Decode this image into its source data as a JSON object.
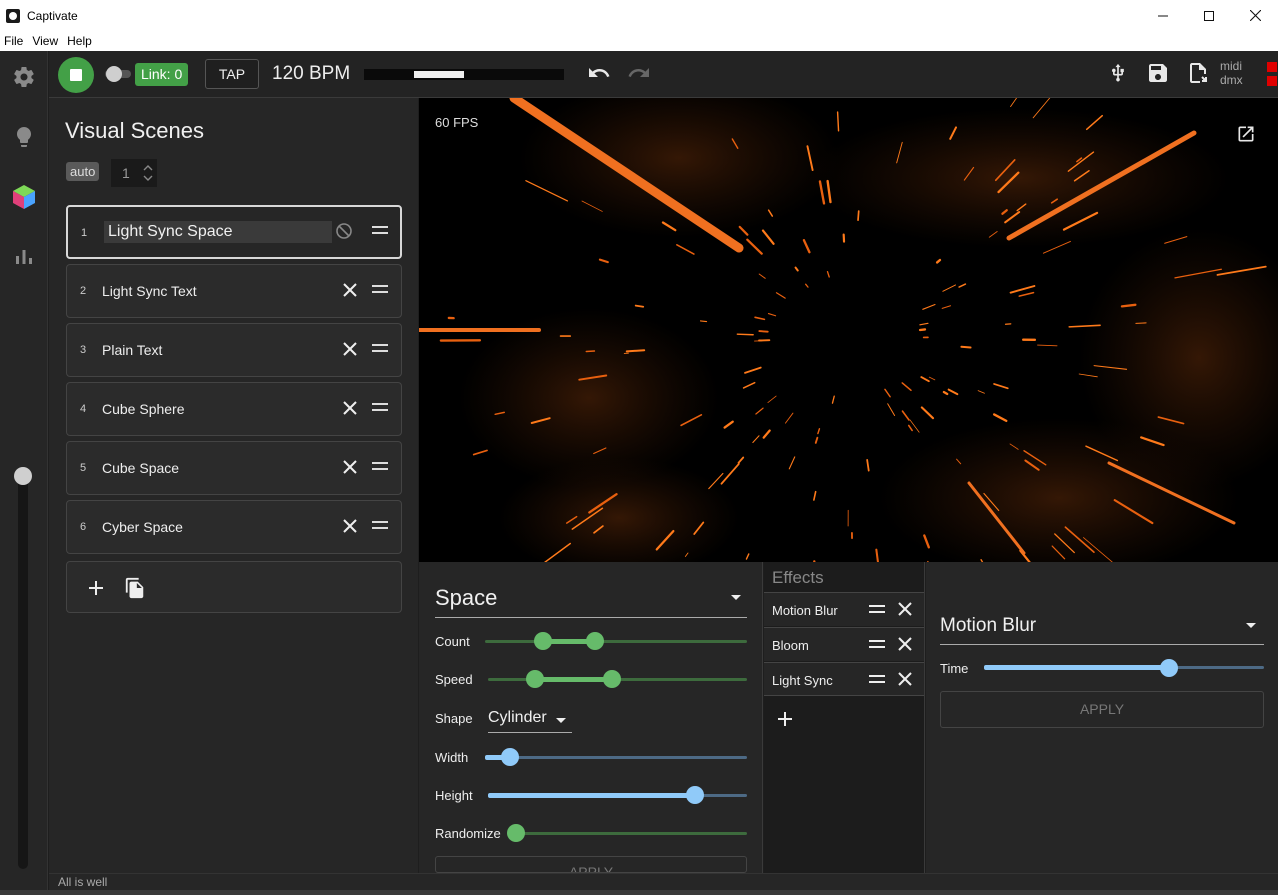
{
  "window": {
    "title": "Captivate"
  },
  "menu": [
    "File",
    "View",
    "Help"
  ],
  "toolbar": {
    "link_label": "Link: 0",
    "tap_label": "TAP",
    "bpm_label": "120 BPM",
    "midi_label": "midi",
    "dmx_label": "dmx",
    "status_color": "#e00000",
    "accent_color": "#43a047"
  },
  "scenes": {
    "title": "Visual Scenes",
    "auto_label": "auto",
    "auto_value": "1",
    "items": [
      {
        "num": "1",
        "name": "Light Sync Space"
      },
      {
        "num": "2",
        "name": "Light Sync Text"
      },
      {
        "num": "3",
        "name": "Plain Text"
      },
      {
        "num": "4",
        "name": "Cube Sphere"
      },
      {
        "num": "5",
        "name": "Cube Space"
      },
      {
        "num": "6",
        "name": "Cyber Space"
      }
    ]
  },
  "preview": {
    "fps_label": "60 FPS"
  },
  "config": {
    "scene_type": "Space",
    "count_label": "Count",
    "speed_label": "Speed",
    "shape_label": "Shape",
    "shape_value": "Cylinder",
    "width_label": "Width",
    "height_label": "Height",
    "randomize_label": "Randomize",
    "apply_label": "APPLY"
  },
  "effects": {
    "title": "Effects",
    "items": [
      "Motion Blur",
      "Bloom",
      "Light Sync"
    ]
  },
  "effect_config": {
    "effect_type": "Motion Blur",
    "time_label": "Time",
    "apply_label": "APPLY"
  },
  "statusbar": {
    "text": "All is well"
  }
}
